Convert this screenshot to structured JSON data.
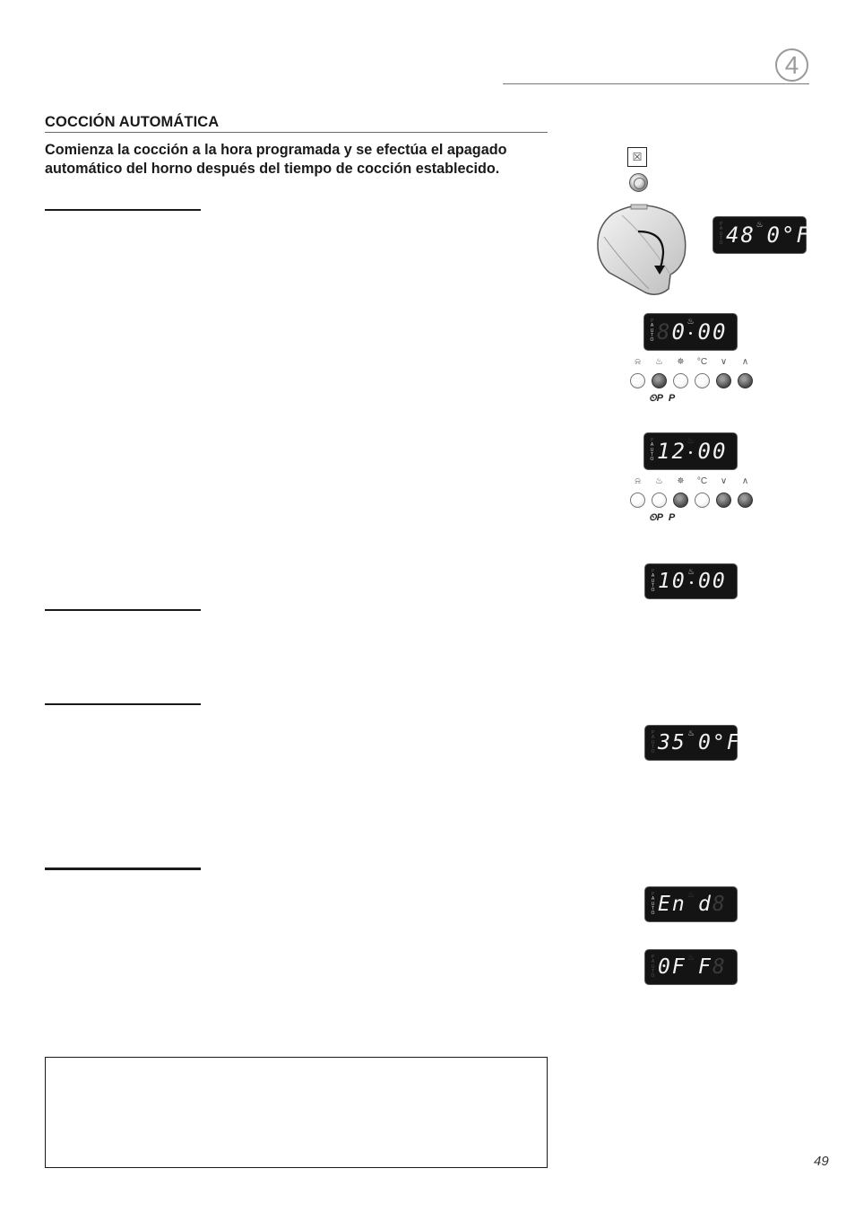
{
  "header": {
    "chapter_number": "4"
  },
  "section": {
    "title": "COCCIÓN AUTOMÁTICA",
    "intro": "Comienza la cocción a la hora programada y se efectúa el apagado automático del horno después del tiempo de cocción establecido."
  },
  "illustrations": {
    "mode_icon": "☒",
    "display_side_labels": [
      "P",
      "A",
      "U",
      "T",
      "O"
    ],
    "displays": [
      {
        "id": "temp-480",
        "text": "48",
        "text2": "0°F",
        "ghost_lead": "",
        "auto_on": false
      },
      {
        "id": "time-000",
        "text": "0",
        "text2": "00",
        "ghost_lead": "8",
        "auto_on": true
      },
      {
        "id": "time-1200",
        "text": "12",
        "text2": "00",
        "ghost_lead": "",
        "auto_on": true
      },
      {
        "id": "time-1000",
        "text": "10",
        "text2": "00",
        "ghost_lead": "",
        "auto_on": true
      },
      {
        "id": "temp-350",
        "text": "35",
        "text2": "0°F",
        "ghost_lead": "",
        "auto_on": false
      },
      {
        "id": "end",
        "text": "En",
        "text2": "d",
        "ghost_tail": "8",
        "auto_on": true
      },
      {
        "id": "off",
        "text": "0F",
        "text2": "F",
        "ghost_tail": "8",
        "auto_on": false
      }
    ],
    "button_symbols": [
      "⍾",
      "♨",
      "✵",
      "°C",
      "∨",
      "∧"
    ],
    "button_labels": [
      "reloj-alarma",
      "tiempo-coccion",
      "fin-coccion",
      "temperatura",
      "menos",
      "mas"
    ],
    "panel_a_pressed": [
      false,
      true,
      false,
      false,
      true,
      true
    ],
    "panel_b_pressed": [
      false,
      false,
      true,
      false,
      true,
      true
    ],
    "program_labels": [
      "⏲P",
      "P"
    ]
  },
  "footer": {
    "page_number": "49"
  }
}
